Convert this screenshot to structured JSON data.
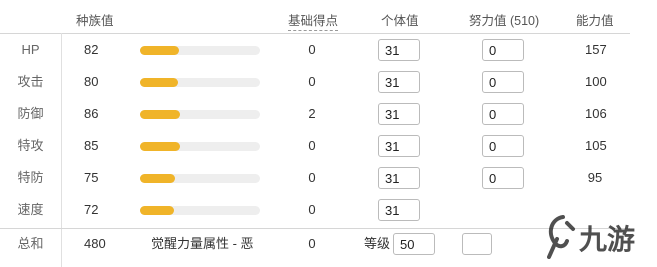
{
  "headers": {
    "base_stat": "种族值",
    "base_points": "基础得点",
    "iv": "个体值",
    "ev": "努力值 (510)",
    "final": "能力值"
  },
  "stats": [
    {
      "name": "HP",
      "base": "82",
      "base_num": 82,
      "bp": "0",
      "iv": "31",
      "ev": "0",
      "final": "157"
    },
    {
      "name": "攻击",
      "base": "80",
      "base_num": 80,
      "bp": "0",
      "iv": "31",
      "ev": "0",
      "final": "100"
    },
    {
      "name": "防御",
      "base": "86",
      "base_num": 86,
      "bp": "2",
      "iv": "31",
      "ev": "0",
      "final": "106"
    },
    {
      "name": "特攻",
      "base": "85",
      "base_num": 85,
      "bp": "0",
      "iv": "31",
      "ev": "0",
      "final": "105"
    },
    {
      "name": "特防",
      "base": "75",
      "base_num": 75,
      "bp": "0",
      "iv": "31",
      "ev": "0",
      "final": "95"
    },
    {
      "name": "速度",
      "base": "72",
      "base_num": 72,
      "bp": "0",
      "iv": "31",
      "ev": "",
      "final": ""
    }
  ],
  "bar_scale_max": 255,
  "total": {
    "label": "总和",
    "base": "480",
    "hidden_power": "觉醒力量属性 - 恶",
    "bp": "0",
    "level_label": "等级",
    "level": "50"
  },
  "watermark_text": "九游",
  "colors": {
    "bar_fill": "#f0b429",
    "bar_track": "#eeeeee",
    "watermark": "#2a2a2a"
  }
}
